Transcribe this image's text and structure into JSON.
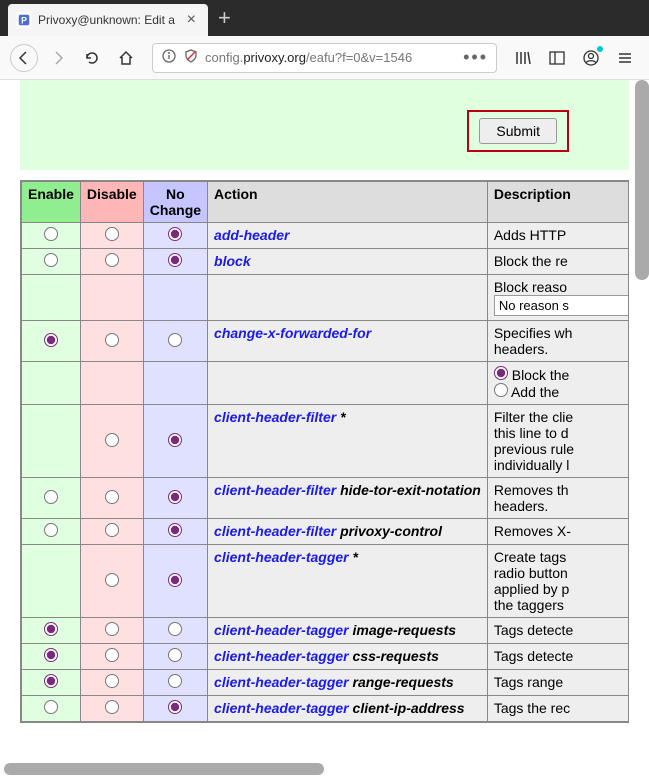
{
  "tab": {
    "title": "Privoxy@unknown: Edit a"
  },
  "url": {
    "prefix": "config.",
    "domain": "privoxy.org",
    "path": "/eafu?f=0&v=1546"
  },
  "submit": {
    "label": "Submit"
  },
  "headers": {
    "enable": "Enable",
    "disable": "Disable",
    "nochange": "No Change",
    "action": "Action",
    "description": "Description"
  },
  "rows": [
    {
      "link": "add-header",
      "suffix": "",
      "desc": "Adds HTTP ",
      "sel": "n",
      "showE": true,
      "showD": true,
      "showN": true
    },
    {
      "link": "block",
      "suffix": "",
      "desc": "Block the re",
      "sel": "n",
      "showE": true,
      "showD": true,
      "showN": true
    },
    {
      "link": "",
      "suffix": "",
      "desc": "Block reaso",
      "sel": "",
      "showE": false,
      "showD": false,
      "showN": false,
      "input": "No reason s"
    },
    {
      "link": "change-x-forwarded-for",
      "suffix": "",
      "desc": "Specifies wh",
      "desc2": "headers.",
      "sel": "e",
      "showE": true,
      "showD": true,
      "showN": true
    },
    {
      "link": "",
      "suffix": "",
      "desc": "",
      "sel": "",
      "showE": false,
      "showD": false,
      "showN": false,
      "radio1": "Block the",
      "radio2": "Add the "
    },
    {
      "link": "client-header-filter",
      "suffix": " *",
      "desc": "Filter the clie",
      "desc2": "this line to d",
      "desc3": "previous rule",
      "desc4": "individually l",
      "sel": "n",
      "showE": false,
      "showD": true,
      "showN": true
    },
    {
      "link": "client-header-filter",
      "suffix": " hide-tor-exit-notation",
      "desc": "Removes th",
      "desc2": "headers.",
      "sel": "n",
      "showE": true,
      "showD": true,
      "showN": true
    },
    {
      "link": "client-header-filter",
      "suffix": " privoxy-control",
      "desc": "Removes X-",
      "sel": "n",
      "showE": true,
      "showD": true,
      "showN": true
    },
    {
      "link": "client-header-tagger",
      "suffix": " *",
      "desc": "Create tags ",
      "desc2": "radio button",
      "desc3": "applied by p",
      "desc4": "the taggers ",
      "sel": "n",
      "showE": false,
      "showD": true,
      "showN": true
    },
    {
      "link": "client-header-tagger",
      "suffix": " image-requests",
      "desc": "Tags detecte",
      "sel": "e",
      "showE": true,
      "showD": true,
      "showN": true
    },
    {
      "link": "client-header-tagger",
      "suffix": " css-requests",
      "desc": "Tags detecte",
      "sel": "e",
      "showE": true,
      "showD": true,
      "showN": true
    },
    {
      "link": "client-header-tagger",
      "suffix": " range-requests",
      "desc": "Tags range ",
      "sel": "e",
      "showE": true,
      "showD": true,
      "showN": true
    },
    {
      "link": "client-header-tagger",
      "suffix": " client-ip-address",
      "desc": "Tags the rec",
      "sel": "n",
      "showE": true,
      "showD": true,
      "showN": true
    }
  ]
}
